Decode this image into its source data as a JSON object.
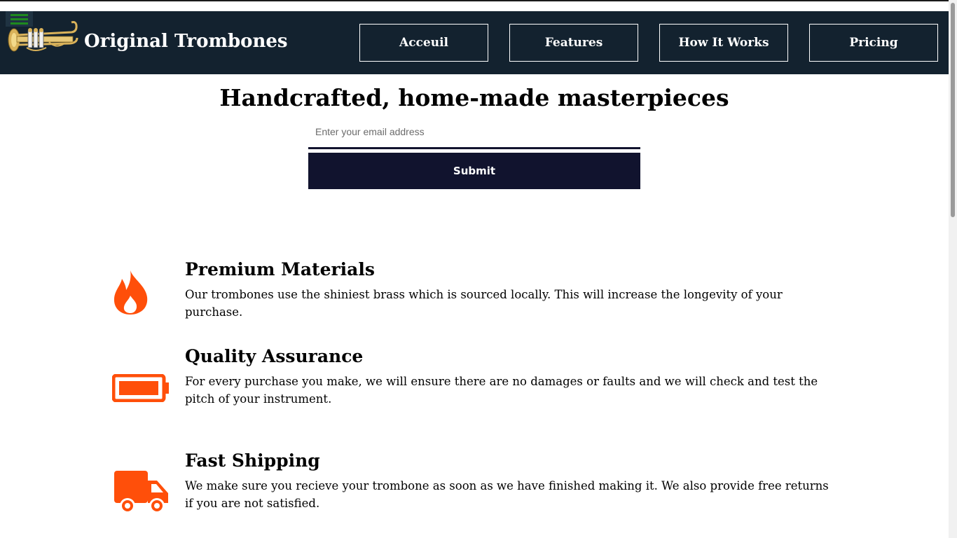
{
  "header": {
    "title": "Original Trombones",
    "nav": [
      {
        "label": "Acceuil"
      },
      {
        "label": "Features"
      },
      {
        "label": "How It Works"
      },
      {
        "label": "Pricing"
      }
    ]
  },
  "hero": {
    "title": "Handcrafted, home-made masterpieces",
    "email_placeholder": "Enter your email address",
    "submit_label": "Submit"
  },
  "features": [
    {
      "icon": "fire-icon",
      "title": "Premium Materials",
      "text": "Our trombones use the shiniest brass which is sourced locally. This will increase the longevity of your purchase."
    },
    {
      "icon": "battery-icon",
      "title": "Quality Assurance",
      "text": "For every purchase you make, we will ensure there are no damages or faults and we will check and test the pitch of your instrument."
    },
    {
      "icon": "truck-icon",
      "title": "Fast Shipping",
      "text": "We make sure you recieve your trombone as soon as we have finished making it. We also provide free returns if you are not satisfied."
    }
  ],
  "colors": {
    "header_bg": "#13222f",
    "accent_icon": "#ff4f0a",
    "button_bg": "#11132e",
    "hamburger": "#1e8a1e"
  }
}
